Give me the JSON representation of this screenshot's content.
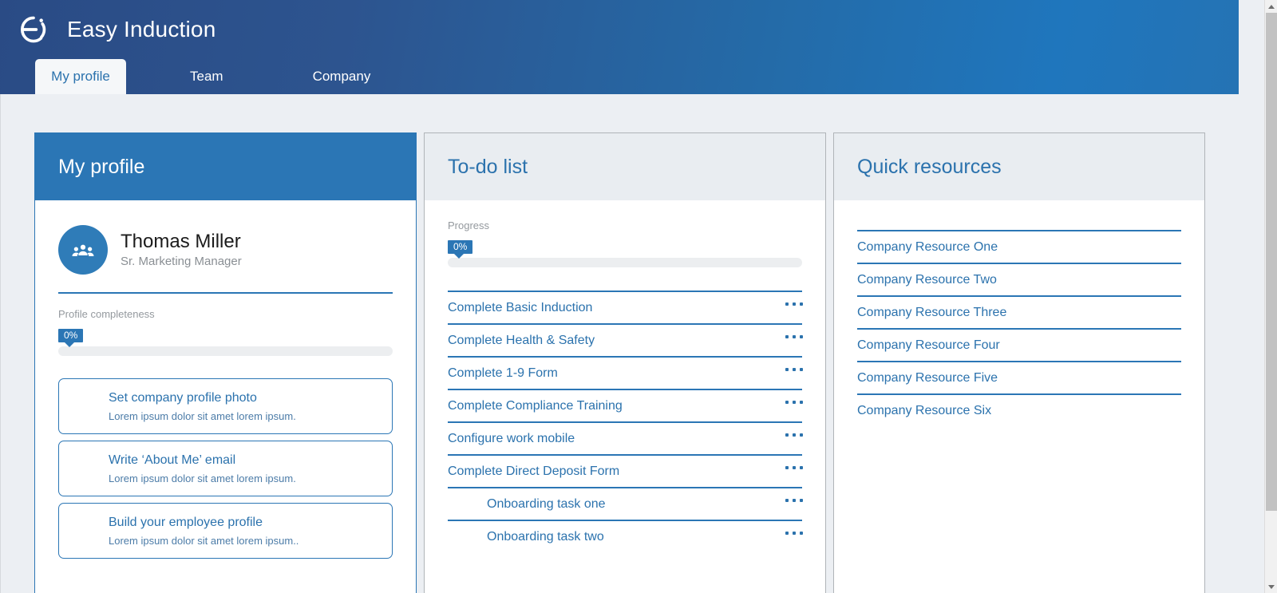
{
  "header": {
    "logo_icon": "easy-induction-logo",
    "title": "Easy Induction",
    "tabs": [
      {
        "label": "My profile",
        "active": true
      },
      {
        "label": "Team",
        "active": false
      },
      {
        "label": "Company",
        "active": false
      }
    ]
  },
  "colors": {
    "brand_blue": "#2b76b5",
    "header_gradient_start": "#2a4b85",
    "header_gradient_end": "#1f76bd",
    "link_blue": "#2b72ad",
    "page_background": "#eceff3",
    "panel_head_grey": "#e9edf1",
    "muted_text": "#94999e",
    "track_grey": "#eceef0"
  },
  "profile_panel": {
    "title": "My profile",
    "avatar_icon": "people-group-icon",
    "name": "Thomas Miller",
    "role": "Sr. Marketing Manager",
    "completeness_label": "Profile completeness",
    "completeness_value": "0%",
    "completeness_percent": 0,
    "actions": [
      {
        "title": "Set company profile photo",
        "subtitle": "Lorem ipsum dolor sit amet lorem ipsum."
      },
      {
        "title": "Write ‘About Me’ email",
        "subtitle": "Lorem ipsum dolor sit amet lorem ipsum."
      },
      {
        "title": "Build your employee profile",
        "subtitle": "Lorem ipsum dolor sit amet lorem ipsum.."
      }
    ]
  },
  "todo_panel": {
    "title": "To-do list",
    "progress_label": "Progress",
    "progress_value": "0%",
    "progress_percent": 0,
    "menu_icon": "ellipsis-icon",
    "tasks": [
      {
        "label": "Complete Basic Induction",
        "indented": false
      },
      {
        "label": "Complete Health & Safety",
        "indented": false
      },
      {
        "label": "Complete 1-9 Form",
        "indented": false
      },
      {
        "label": "Complete Compliance Training",
        "indented": false
      },
      {
        "label": "Configure work mobile",
        "indented": false
      },
      {
        "label": "Complete Direct Deposit Form",
        "indented": false
      },
      {
        "label": "Onboarding task one",
        "indented": true
      },
      {
        "label": "Onboarding task two",
        "indented": true
      }
    ]
  },
  "resources_panel": {
    "title": "Quick resources",
    "items": [
      {
        "label": "Company Resource One"
      },
      {
        "label": "Company Resource Two"
      },
      {
        "label": "Company Resource Three"
      },
      {
        "label": "Company Resource Four"
      },
      {
        "label": "Company Resource Five"
      },
      {
        "label": "Company Resource Six"
      }
    ]
  },
  "scrollbar": {
    "up_icon": "scroll-up-arrow-icon",
    "down_icon": "scroll-down-arrow-icon"
  }
}
